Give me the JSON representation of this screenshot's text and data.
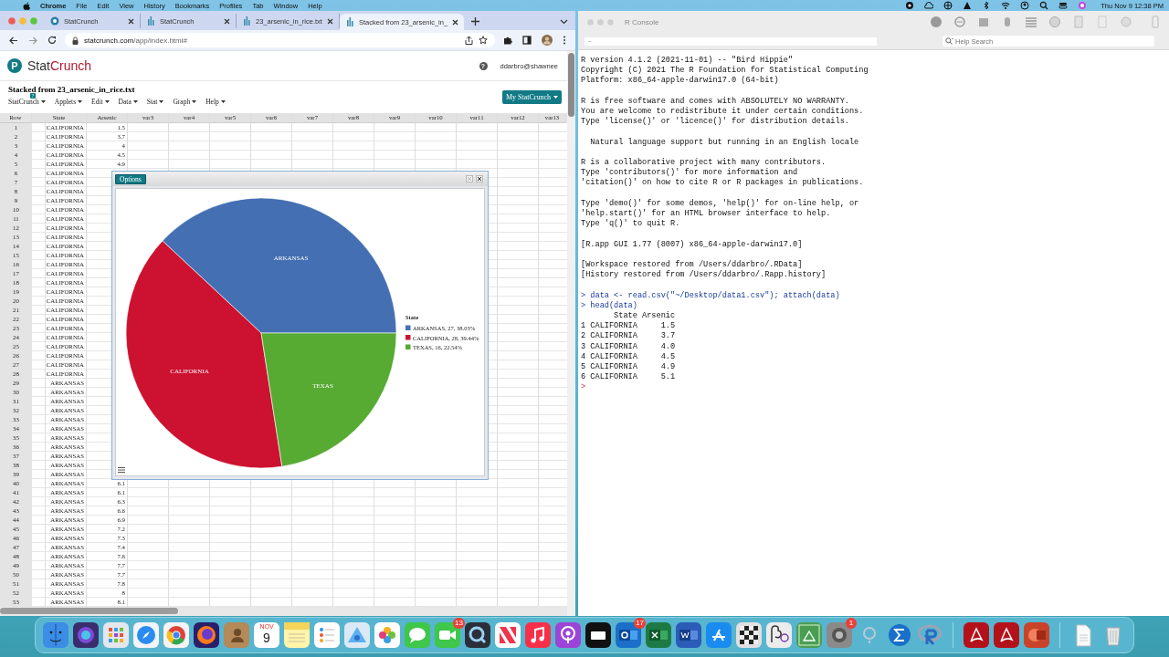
{
  "menubar": {
    "app": "Chrome",
    "menus": [
      "File",
      "Edit",
      "View",
      "History",
      "Bookmarks",
      "Profiles",
      "Tab",
      "Window",
      "Help"
    ],
    "clock": "Thu Nov 9  12:38 PM"
  },
  "browser": {
    "tabs": [
      {
        "title": "StatCrunch",
        "kind": "round",
        "selected": false
      },
      {
        "title": "StatCrunch",
        "kind": "bars",
        "selected": false
      },
      {
        "title": "23_arsenic_in_rice.txt",
        "kind": "bars",
        "selected": false
      },
      {
        "title": "Stacked from 23_arsenic_in_",
        "kind": "bars",
        "selected": true
      }
    ],
    "url_host": "statcrunch.com",
    "url_path": "/app/index.html#"
  },
  "statcrunch": {
    "logo_mark": "P",
    "brand": [
      "Stat",
      "Crunch"
    ],
    "help_icon": "?",
    "user": "ddarbro@shawnee",
    "title": "Stacked from 23_arsenic_in_rice.txt",
    "help_badge": "?",
    "menus": [
      "StatCrunch",
      "Applets",
      "Edit",
      "Data",
      "Stat",
      "Graph",
      "Help"
    ],
    "account_button": "My StatCrunch",
    "table": {
      "columns": [
        "Row",
        "State",
        "Arsenic",
        "var3",
        "var4",
        "var5",
        "var6",
        "var7",
        "var8",
        "var9",
        "var10",
        "var11",
        "var12",
        "var13"
      ],
      "rows": [
        {
          "row": "1",
          "state": "CALIFORNIA",
          "arsenic": "1.5"
        },
        {
          "row": "2",
          "state": "CALIFORNIA",
          "arsenic": "3.7"
        },
        {
          "row": "3",
          "state": "CALIFORNIA",
          "arsenic": "4"
        },
        {
          "row": "4",
          "state": "CALIFORNIA",
          "arsenic": "4.5"
        },
        {
          "row": "5",
          "state": "CALIFORNIA",
          "arsenic": "4.9"
        },
        {
          "row": "6",
          "state": "CALIFORNIA"
        },
        {
          "row": "7",
          "state": "CALIFORNIA"
        },
        {
          "row": "8",
          "state": "CALIFORNIA"
        },
        {
          "row": "9",
          "state": "CALIFORNIA"
        },
        {
          "row": "10",
          "state": "CALIFORNIA"
        },
        {
          "row": "11",
          "state": "CALIFORNIA"
        },
        {
          "row": "12",
          "state": "CALIFORNIA"
        },
        {
          "row": "13",
          "state": "CALIFORNIA"
        },
        {
          "row": "14",
          "state": "CALIFORNIA"
        },
        {
          "row": "15",
          "state": "CALIFORNIA"
        },
        {
          "row": "16",
          "state": "CALIFORNIA"
        },
        {
          "row": "17",
          "state": "CALIFORNIA"
        },
        {
          "row": "18",
          "state": "CALIFORNIA"
        },
        {
          "row": "19",
          "state": "CALIFORNIA"
        },
        {
          "row": "20",
          "state": "CALIFORNIA"
        },
        {
          "row": "21",
          "state": "CALIFORNIA"
        },
        {
          "row": "22",
          "state": "CALIFORNIA"
        },
        {
          "row": "23",
          "state": "CALIFORNIA"
        },
        {
          "row": "24",
          "state": "CALIFORNIA"
        },
        {
          "row": "25",
          "state": "CALIFORNIA"
        },
        {
          "row": "26",
          "state": "CALIFORNIA"
        },
        {
          "row": "27",
          "state": "CALIFORNIA"
        },
        {
          "row": "28",
          "state": "CALIFORNIA"
        },
        {
          "row": "29",
          "state": "ARKANSAS"
        },
        {
          "row": "30",
          "state": "ARKANSAS"
        },
        {
          "row": "31",
          "state": "ARKANSAS"
        },
        {
          "row": "32",
          "state": "ARKANSAS"
        },
        {
          "row": "33",
          "state": "ARKANSAS"
        },
        {
          "row": "34",
          "state": "ARKANSAS"
        },
        {
          "row": "35",
          "state": "ARKANSAS"
        },
        {
          "row": "36",
          "state": "ARKANSAS"
        },
        {
          "row": "37",
          "state": "ARKANSAS"
        },
        {
          "row": "38",
          "state": "ARKANSAS"
        },
        {
          "row": "39",
          "state": "ARKANSAS"
        },
        {
          "row": "40",
          "state": "ARKANSAS",
          "arsenic": "6.1"
        },
        {
          "row": "41",
          "state": "ARKANSAS",
          "arsenic": "6.1"
        },
        {
          "row": "42",
          "state": "ARKANSAS",
          "arsenic": "6.3"
        },
        {
          "row": "43",
          "state": "ARKANSAS",
          "arsenic": "6.6"
        },
        {
          "row": "44",
          "state": "ARKANSAS",
          "arsenic": "6.9"
        },
        {
          "row": "45",
          "state": "ARKANSAS",
          "arsenic": "7.2"
        },
        {
          "row": "46",
          "state": "ARKANSAS",
          "arsenic": "7.3"
        },
        {
          "row": "47",
          "state": "ARKANSAS",
          "arsenic": "7.4"
        },
        {
          "row": "48",
          "state": "ARKANSAS",
          "arsenic": "7.6"
        },
        {
          "row": "49",
          "state": "ARKANSAS",
          "arsenic": "7.7"
        },
        {
          "row": "50",
          "state": "ARKANSAS",
          "arsenic": "7.7"
        },
        {
          "row": "51",
          "state": "ARKANSAS",
          "arsenic": "7.8"
        },
        {
          "row": "52",
          "state": "ARKANSAS",
          "arsenic": "8"
        },
        {
          "row": "53",
          "state": "ARKANSAS",
          "arsenic": "8.1"
        }
      ]
    },
    "dialog": {
      "options_button": "Options",
      "chart_data": {
        "type": "pie",
        "categories": [
          "ARKANSAS",
          "CALIFORNIA",
          "TEXAS"
        ],
        "values": [
          38.03,
          39.44,
          22.54
        ]
      },
      "legend": {
        "title": "State",
        "items": [
          {
            "label": "ARKANSAS, 27, 38.03%",
            "color": "#4470b3"
          },
          {
            "label": "CALIFORNIA, 28, 39.44%",
            "color": "#cc1230"
          },
          {
            "label": "TEXAS, 16, 22.54%",
            "color": "#57aa32"
          }
        ]
      }
    }
  },
  "console": {
    "title": "R Console",
    "path": "~",
    "help_placeholder": "Help Search",
    "paragraphs": [
      [
        {
          "kind": "output",
          "text": "R version 4.1.2 (2021-11-01) -- \"Bird Hippie\""
        },
        {
          "kind": "output",
          "text": "Copyright (C) 2021 The R Foundation for Statistical Computing"
        },
        {
          "kind": "output",
          "text": "Platform: x86_64-apple-darwin17.0 (64-bit)"
        }
      ],
      [
        {
          "kind": "output",
          "text": "R is free software and comes with ABSOLUTELY NO WARRANTY."
        },
        {
          "kind": "output",
          "text": "You are welcome to redistribute it under certain conditions."
        },
        {
          "kind": "output",
          "text": "Type 'license()' or 'licence()' for distribution details."
        }
      ],
      [
        {
          "kind": "output",
          "text": "  Natural language support but running in an English locale"
        }
      ],
      [
        {
          "kind": "output",
          "text": "R is a collaborative project with many contributors."
        },
        {
          "kind": "output",
          "text": "Type 'contributors()' for more information and"
        },
        {
          "kind": "output",
          "text": "'citation()' on how to cite R or R packages in publications."
        }
      ],
      [
        {
          "kind": "output",
          "text": "Type 'demo()' for some demos, 'help()' for on-line help, or"
        },
        {
          "kind": "output",
          "text": "'help.start()' for an HTML browser interface to help."
        },
        {
          "kind": "output",
          "text": "Type 'q()' to quit R."
        }
      ],
      [
        {
          "kind": "output",
          "text": "[R.app GUI 1.77 (8007) x86_64-apple-darwin17.0]"
        }
      ],
      [
        {
          "kind": "output",
          "text": "[Workspace restored from /Users/ddarbro/.RData]"
        },
        {
          "kind": "output",
          "text": "[History restored from /Users/ddarbro/.Rapp.history]"
        }
      ],
      [
        {
          "kind": "command",
          "prompt": ">",
          "text": "data <- read.csv(\"~/Desktop/data1.csv\"); attach(data)"
        },
        {
          "kind": "command",
          "prompt": ">",
          "text": "head(data)"
        },
        {
          "kind": "output",
          "text": "       State Arsenic"
        },
        {
          "kind": "output",
          "text": "1 CALIFORNIA     1.5"
        },
        {
          "kind": "output",
          "text": "2 CALIFORNIA     3.7"
        },
        {
          "kind": "output",
          "text": "3 CALIFORNIA     4.0"
        },
        {
          "kind": "output",
          "text": "4 CALIFORNIA     4.5"
        },
        {
          "kind": "output",
          "text": "5 CALIFORNIA     4.9"
        },
        {
          "kind": "output",
          "text": "6 CALIFORNIA     5.1"
        },
        {
          "kind": "prompt",
          "prompt": ">"
        }
      ]
    ]
  },
  "dock": [
    {
      "kind": "finder"
    },
    {
      "kind": "siri"
    },
    {
      "kind": "launchpad"
    },
    {
      "kind": "safari"
    },
    {
      "kind": "chrome"
    },
    {
      "kind": "firefox"
    },
    {
      "kind": "contacts"
    },
    {
      "kind": "calendar",
      "month": "NOV",
      "day": "9"
    },
    {
      "kind": "notes"
    },
    {
      "kind": "reminders"
    },
    {
      "kind": "maps"
    },
    {
      "kind": "photos"
    },
    {
      "kind": "messages"
    },
    {
      "kind": "facetime",
      "badge": "13"
    },
    {
      "kind": "quicktime"
    },
    {
      "kind": "news"
    },
    {
      "kind": "music"
    },
    {
      "kind": "podcasts"
    },
    {
      "kind": "tv"
    },
    {
      "kind": "outlook",
      "badge": "17"
    },
    {
      "kind": "excel"
    },
    {
      "kind": "word"
    },
    {
      "kind": "appstore"
    },
    {
      "kind": "chess"
    },
    {
      "kind": "greek"
    },
    {
      "kind": "geometry"
    },
    {
      "kind": "settings",
      "badge": "1"
    },
    {
      "kind": "help"
    },
    {
      "kind": "sigma"
    },
    {
      "kind": "rapp"
    },
    {
      "kind": "separator"
    },
    {
      "kind": "acrobat"
    },
    {
      "kind": "acrobat"
    },
    {
      "kind": "slides"
    },
    {
      "kind": "separator"
    },
    {
      "kind": "document"
    },
    {
      "kind": "trash"
    }
  ]
}
